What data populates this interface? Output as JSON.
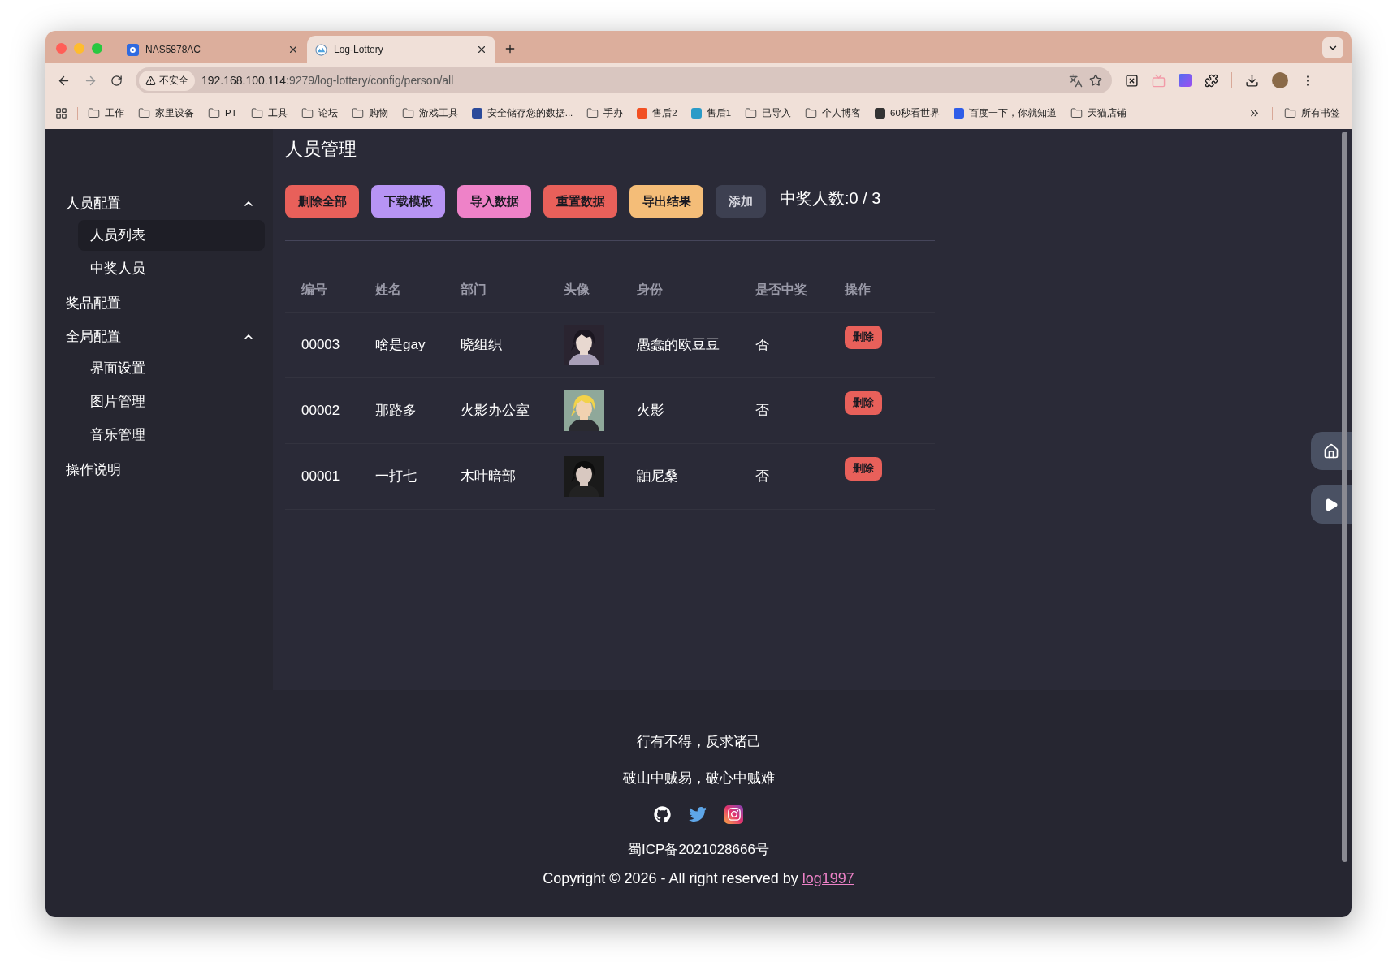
{
  "browser": {
    "tabs": [
      {
        "title": "NAS5878AC",
        "selected": false
      },
      {
        "title": "Log-Lottery",
        "selected": true
      }
    ],
    "address_bar": {
      "security": "不安全",
      "host": "192.168.100.114",
      "path": ":9279/log-lottery/config/person/all"
    },
    "bookmarks": [
      {
        "label": "工作",
        "kind": "folder"
      },
      {
        "label": "家里设备",
        "kind": "folder"
      },
      {
        "label": "PT",
        "kind": "folder"
      },
      {
        "label": "工具",
        "kind": "folder"
      },
      {
        "label": "论坛",
        "kind": "folder"
      },
      {
        "label": "购物",
        "kind": "folder"
      },
      {
        "label": "游戏工具",
        "kind": "folder"
      },
      {
        "label": "安全储存您的数据...",
        "kind": "site",
        "color": "#2b4a9a"
      },
      {
        "label": "手办",
        "kind": "folder"
      },
      {
        "label": "售后2",
        "kind": "site",
        "color": "#f25022"
      },
      {
        "label": "售后1",
        "kind": "site",
        "color": "#2a9bc8"
      },
      {
        "label": "已导入",
        "kind": "folder"
      },
      {
        "label": "个人博客",
        "kind": "folder"
      },
      {
        "label": "60秒看世界",
        "kind": "site",
        "color": "#333333"
      },
      {
        "label": "百度一下，你就知道",
        "kind": "site",
        "color": "#2f5de8"
      },
      {
        "label": "天猫店铺",
        "kind": "folder"
      }
    ],
    "all_bookmarks": "所有书签"
  },
  "sidebar": {
    "items": [
      {
        "label": "人员配置",
        "expanded": true,
        "children": [
          {
            "label": "人员列表",
            "selected": true
          },
          {
            "label": "中奖人员",
            "selected": false
          }
        ]
      },
      {
        "label": "奖品配置"
      },
      {
        "label": "全局配置",
        "expanded": true,
        "children": [
          {
            "label": "界面设置",
            "selected": false
          },
          {
            "label": "图片管理",
            "selected": false
          },
          {
            "label": "音乐管理",
            "selected": false
          }
        ]
      },
      {
        "label": "操作说明"
      }
    ]
  },
  "page": {
    "title": "人员管理",
    "actions": [
      {
        "label": "删除全部",
        "color": "#e8605a"
      },
      {
        "label": "下载模板",
        "color": "#b794f4"
      },
      {
        "label": "导入数据",
        "color": "#ee82c8"
      },
      {
        "label": "重置数据",
        "color": "#e8605a"
      },
      {
        "label": "导出结果",
        "color": "#f4bd78"
      },
      {
        "label": "添加",
        "color": "#3d4051"
      }
    ],
    "winner_count": "中奖人数:0 / 3",
    "table": {
      "columns": [
        "编号",
        "姓名",
        "部门",
        "头像",
        "身份",
        "是否中奖",
        "操作"
      ],
      "rows": [
        {
          "id": "00003",
          "name": "啥是gay",
          "department": "晓组织",
          "identity": "愚蠢的欧豆豆",
          "winner": "否",
          "action": "删除"
        },
        {
          "id": "00002",
          "name": "那路多",
          "department": "火影办公室",
          "identity": "火影",
          "winner": "否",
          "action": "删除"
        },
        {
          "id": "00001",
          "name": "一打七",
          "department": "木叶暗部",
          "identity": "鼬尼桑",
          "winner": "否",
          "action": "删除"
        }
      ]
    }
  },
  "footer": {
    "mottos": [
      "行有不得，反求诸己",
      "破山中贼易，破心中贼难"
    ],
    "icp": "蜀ICP备2021028666号",
    "copyright": "Copyright © 2026 - All right reserved by ",
    "author_link": "log1997"
  }
}
